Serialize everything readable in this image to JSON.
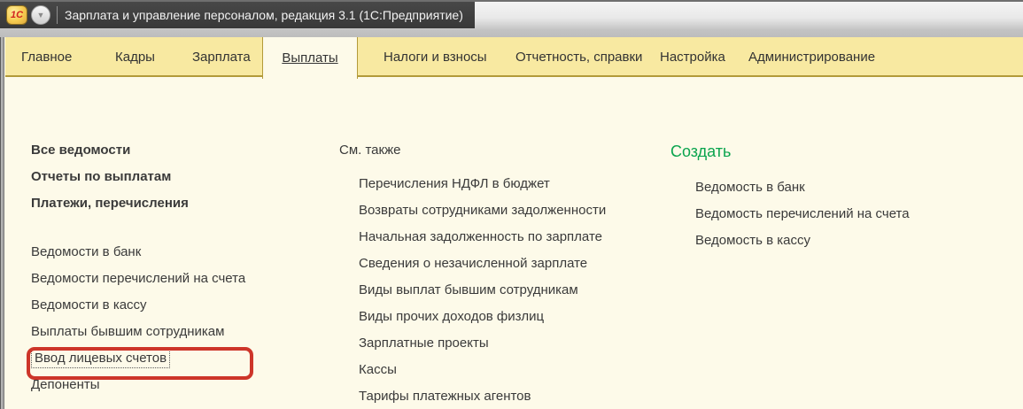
{
  "window": {
    "title": "Зарплата и управление персоналом, редакция 3.1  (1С:Предприятие)",
    "logo_text": "1С",
    "dropdown_icon": "▼"
  },
  "tabs": [
    {
      "label": "Главное",
      "active": false
    },
    {
      "label": "Кадры",
      "active": false
    },
    {
      "label": "Зарплата",
      "active": false
    },
    {
      "label": "Выплаты",
      "active": true
    },
    {
      "label": "Налоги и взносы",
      "active": false
    },
    {
      "label": "Отчетность, справки",
      "active": false
    },
    {
      "label": "Настройка",
      "active": false
    },
    {
      "label": "Администрирование",
      "active": false
    }
  ],
  "panel": {
    "featured": [
      "Все ведомости",
      "Отчеты по выплатам",
      "Платежи, перечисления"
    ],
    "commands": [
      "Ведомости в банк",
      "Ведомости перечислений на счета",
      "Ведомости в кассу",
      "Выплаты бывшим сотрудникам",
      "Ввод лицевых счетов",
      "Депоненты"
    ],
    "see_also": {
      "header": "См. также",
      "items": [
        "Перечисления НДФЛ в бюджет",
        "Возвраты сотрудниками задолженности",
        "Начальная задолженность по зарплате",
        "Сведения о незачисленной зарплате",
        "Виды выплат бывшим сотрудникам",
        "Виды прочих доходов физлиц",
        "Зарплатные проекты",
        "Кассы",
        "Тарифы платежных агентов"
      ]
    },
    "create": {
      "header": "Создать",
      "items": [
        "Ведомость в банк",
        "Ведомость перечислений на счета",
        "Ведомость в кассу"
      ]
    }
  },
  "annotation": {
    "target": "Ввод лицевых счетов",
    "shape": "red-rounded-rectangle",
    "color": "#cd3529"
  },
  "colors": {
    "tabbar_yellow": "#f8e9a1",
    "tabbar_border": "#b29a39",
    "content_cream": "#fdfae9",
    "titlebar_dark": "#3f3f3f",
    "accent_green": "#0aa44e",
    "annotation_red": "#cd3529"
  }
}
